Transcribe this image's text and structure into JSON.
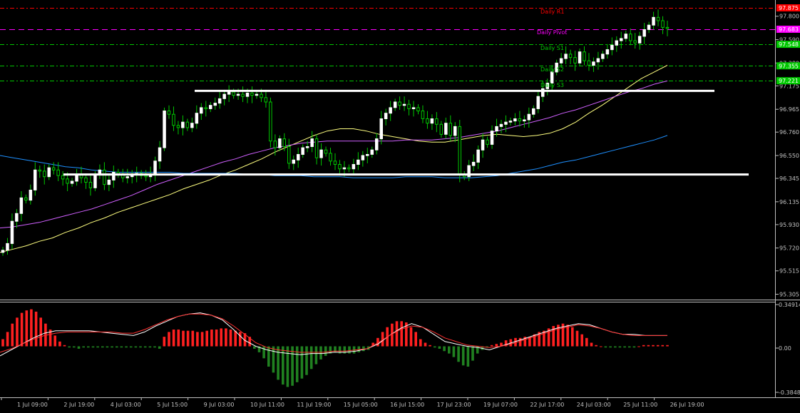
{
  "colors": {
    "background": "#000000",
    "axis": "#c0c0c0",
    "bull_candle": "#ffffff",
    "candle_wick": "#00c800",
    "r1_line": "#ff0000",
    "pivot_line": "#ff00ff",
    "support_line": "#00c800",
    "level_line": "#ffffff",
    "ma_fast": "#ffff80",
    "ma_mid": "#d060ff",
    "ma_slow": "#1e90ff",
    "hist_up": "#ff2020",
    "hist_down": "#208020",
    "signal_white": "#ffffff",
    "signal_red": "#ff3030"
  },
  "main": {
    "pivot_labels": [
      "Daily R1",
      "Daily Pivot",
      "Daily S1",
      "Daily S2",
      "Daily S3"
    ],
    "price_ticks": [
      "97.800",
      "97.590",
      "97.380",
      "97.175",
      "96.965",
      "96.760",
      "96.550",
      "96.345",
      "96.135",
      "95.930",
      "95.720",
      "95.515",
      "95.305"
    ],
    "price_tags": [
      {
        "text": "97.875",
        "value": 97.875,
        "color": "#ff0000",
        "kind": "r1"
      },
      {
        "text": "97.683",
        "value": 97.683,
        "color": "#ff00ff",
        "kind": "pivot"
      },
      {
        "text": "97.548",
        "value": 97.548,
        "color": "#00c800",
        "kind": "s1"
      },
      {
        "text": "97.355",
        "value": 97.355,
        "color": "#00c800",
        "kind": "s2"
      },
      {
        "text": "97.221",
        "value": 97.221,
        "color": "#00c800",
        "kind": "s3"
      }
    ]
  },
  "macd": {
    "ticks": [
      "0.34914",
      "0.00",
      "-0.38487"
    ]
  },
  "time_axis": {
    "labels": [
      "1 Jul 09:00",
      "2 Jul 19:00",
      "4 Jul 03:00",
      "5 Jul 15:00",
      "9 Jul 03:00",
      "10 Jul 11:00",
      "11 Jul 19:00",
      "15 Jul 05:00",
      "16 Jul 15:00",
      "17 Jul 23:00",
      "19 Jul 07:00",
      "22 Jul 17:00",
      "24 Jul 03:00",
      "25 Jul 11:00",
      "26 Jul 19:00"
    ]
  },
  "chart_data": [
    {
      "type": "candlestick",
      "y_axis": {
        "min": 95.27,
        "max": 97.92
      },
      "horizontal_levels": [
        {
          "name": "Daily R1",
          "value": 97.875
        },
        {
          "name": "Daily Pivot",
          "value": 97.683
        },
        {
          "name": "Daily S1",
          "value": 97.548
        },
        {
          "name": "Daily S2",
          "value": 97.355
        },
        {
          "name": "Daily S3",
          "value": 97.221
        },
        {
          "name": "resistance",
          "value": 97.13
        },
        {
          "name": "support",
          "value": 96.38
        }
      ],
      "closes": [
        95.7,
        95.76,
        95.96,
        96.03,
        96.17,
        96.15,
        96.24,
        96.42,
        96.41,
        96.36,
        96.44,
        96.42,
        96.37,
        96.34,
        96.3,
        96.32,
        96.38,
        96.35,
        96.31,
        96.26,
        96.38,
        96.42,
        96.29,
        96.33,
        96.4,
        96.38,
        96.35,
        96.36,
        96.38,
        96.39,
        96.37,
        96.36,
        96.38,
        96.5,
        96.62,
        96.95,
        96.92,
        96.82,
        96.8,
        96.85,
        96.8,
        96.84,
        96.93,
        96.98,
        96.97,
        97.0,
        97.02,
        97.06,
        97.1,
        97.12,
        97.09,
        97.1,
        97.08,
        97.11,
        97.09,
        97.1,
        97.07,
        97.03,
        96.68,
        96.62,
        96.7,
        96.63,
        96.48,
        96.51,
        96.56,
        96.62,
        96.63,
        96.7,
        96.53,
        96.6,
        96.57,
        96.5,
        96.47,
        96.43,
        96.44,
        96.43,
        96.47,
        96.51,
        96.55,
        96.56,
        96.6,
        96.7,
        96.88,
        96.93,
        96.98,
        97.03,
        97.0,
        97.01,
        96.97,
        96.98,
        96.95,
        96.88,
        96.84,
        96.88,
        96.83,
        96.74,
        96.84,
        96.73,
        96.81,
        96.38,
        96.36,
        96.46,
        96.49,
        96.6,
        96.69,
        96.65,
        96.77,
        96.81,
        96.83,
        96.85,
        96.86,
        96.88,
        96.86,
        96.87,
        96.92,
        96.97,
        97.08,
        97.15,
        97.2,
        97.3,
        97.38,
        97.42,
        97.46,
        97.43,
        97.38,
        97.48,
        97.4,
        97.36,
        97.39,
        97.42,
        97.46,
        97.5,
        97.54,
        97.58,
        97.6,
        97.64,
        97.58,
        97.56,
        97.62,
        97.68,
        97.72,
        97.79,
        97.76,
        97.7,
        97.69
      ],
      "moving_averages": [
        {
          "values": [
            95.68,
            95.71,
            95.74,
            95.78,
            95.81,
            95.86,
            95.9,
            95.95,
            95.99,
            96.04,
            96.08,
            96.12,
            96.16,
            96.2,
            96.25,
            96.29,
            96.33,
            96.38,
            96.42,
            96.47,
            96.52,
            96.58,
            96.63,
            96.68,
            96.73,
            96.77,
            96.79,
            96.79,
            96.77,
            96.74,
            96.72,
            96.7,
            96.68,
            96.67,
            96.67,
            96.69,
            96.71,
            96.73,
            96.74,
            96.73,
            96.72,
            96.73,
            96.75,
            96.79,
            96.85,
            96.93,
            97.0,
            97.08,
            97.16,
            97.24,
            97.3,
            97.36
          ]
        },
        {
          "values": [
            95.9,
            95.91,
            95.93,
            95.95,
            95.98,
            96.01,
            96.04,
            96.07,
            96.11,
            96.15,
            96.19,
            96.24,
            96.29,
            96.33,
            96.37,
            96.41,
            96.45,
            96.49,
            96.52,
            96.56,
            96.59,
            96.62,
            96.64,
            96.66,
            96.67,
            96.68,
            96.68,
            96.68,
            96.68,
            96.68,
            96.68,
            96.69,
            96.69,
            96.69,
            96.7,
            96.71,
            96.73,
            96.75,
            96.77,
            96.8,
            96.83,
            96.86,
            96.89,
            96.93,
            96.96,
            97.0,
            97.04,
            97.08,
            97.12,
            97.15,
            97.19,
            97.22
          ]
        },
        {
          "values": [
            96.55,
            96.53,
            96.51,
            96.49,
            96.47,
            96.45,
            96.44,
            96.42,
            96.41,
            96.4,
            96.4,
            96.4,
            96.4,
            96.4,
            96.39,
            96.39,
            96.39,
            96.39,
            96.39,
            96.38,
            96.38,
            96.37,
            96.37,
            96.37,
            96.36,
            96.36,
            96.36,
            96.35,
            96.35,
            96.35,
            96.35,
            96.36,
            96.36,
            96.36,
            96.35,
            96.35,
            96.35,
            96.36,
            96.37,
            96.39,
            96.41,
            96.43,
            96.46,
            96.49,
            96.51,
            96.54,
            96.57,
            96.6,
            96.63,
            96.66,
            96.69,
            96.73
          ]
        }
      ]
    },
    {
      "type": "bar",
      "name": "MACD",
      "y_axis": {
        "min": -0.38487,
        "max": 0.34914
      },
      "histogram": [
        0.06,
        0.12,
        0.19,
        0.24,
        0.28,
        0.3,
        0.31,
        0.29,
        0.24,
        0.19,
        0.14,
        0.09,
        0.04,
        0.01,
        -0.01,
        -0.01,
        -0.02,
        -0.01,
        -0.01,
        -0.01,
        -0.01,
        -0.01,
        -0.01,
        -0.01,
        -0.01,
        -0.01,
        -0.01,
        -0.01,
        -0.01,
        -0.01,
        -0.01,
        -0.01,
        -0.01,
        -0.02,
        0.08,
        0.12,
        0.14,
        0.14,
        0.13,
        0.13,
        0.13,
        0.12,
        0.12,
        0.13,
        0.14,
        0.14,
        0.15,
        0.15,
        0.14,
        0.13,
        0.12,
        0.11,
        0.08,
        -0.02,
        -0.05,
        -0.1,
        -0.17,
        -0.22,
        -0.28,
        -0.32,
        -0.34,
        -0.33,
        -0.3,
        -0.27,
        -0.24,
        -0.19,
        -0.15,
        -0.11,
        -0.08,
        -0.06,
        -0.05,
        -0.06,
        -0.06,
        -0.06,
        -0.06,
        -0.05,
        -0.04,
        -0.03,
        0.03,
        0.07,
        0.12,
        0.16,
        0.19,
        0.21,
        0.21,
        0.2,
        0.16,
        0.12,
        0.06,
        0.03,
        0.01,
        -0.01,
        -0.02,
        -0.04,
        -0.06,
        -0.09,
        -0.13,
        -0.16,
        -0.17,
        -0.12,
        -0.06,
        -0.03,
        -0.01,
        0.01,
        0.02,
        0.03,
        0.05,
        0.06,
        0.07,
        0.07,
        0.08,
        0.08,
        0.1,
        0.12,
        0.13,
        0.15,
        0.17,
        0.18,
        0.19,
        0.18,
        0.16,
        0.13,
        0.1,
        0.07,
        0.03,
        0.01,
        0.0,
        -0.01,
        -0.01,
        -0.01,
        -0.01,
        -0.01,
        -0.01,
        -0.01,
        0.0,
        0.01,
        0.01,
        0.01,
        0.01,
        0.01,
        0.01
      ],
      "signal_lines": [
        {
          "values": [
            -0.08,
            -0.03,
            0.02,
            0.07,
            0.11,
            0.13,
            0.13,
            0.13,
            0.13,
            0.12,
            0.11,
            0.1,
            0.09,
            0.12,
            0.17,
            0.21,
            0.25,
            0.27,
            0.28,
            0.26,
            0.22,
            0.14,
            0.05,
            0.0,
            -0.03,
            -0.05,
            -0.06,
            -0.07,
            -0.06,
            -0.06,
            -0.05,
            -0.05,
            -0.04,
            -0.02,
            0.02,
            0.09,
            0.15,
            0.19,
            0.16,
            0.1,
            0.04,
            0.02,
            0.0,
            -0.01,
            -0.03,
            0.0,
            0.03,
            0.06,
            0.09,
            0.12,
            0.15,
            0.17,
            0.19,
            0.18,
            0.15,
            0.12,
            0.1,
            0.1,
            0.09,
            0.09,
            0.09
          ]
        },
        {
          "values": [
            -0.05,
            -0.02,
            0.02,
            0.06,
            0.09,
            0.11,
            0.12,
            0.12,
            0.12,
            0.12,
            0.12,
            0.11,
            0.11,
            0.14,
            0.18,
            0.22,
            0.25,
            0.27,
            0.27,
            0.26,
            0.23,
            0.17,
            0.1,
            0.03,
            -0.01,
            -0.03,
            -0.04,
            -0.05,
            -0.05,
            -0.05,
            -0.04,
            -0.04,
            -0.03,
            -0.02,
            0.03,
            0.09,
            0.14,
            0.17,
            0.16,
            0.12,
            0.07,
            0.04,
            0.01,
            0.0,
            -0.01,
            0.0,
            0.02,
            0.05,
            0.08,
            0.11,
            0.14,
            0.16,
            0.18,
            0.17,
            0.15,
            0.12,
            0.1,
            0.09,
            0.09,
            0.09,
            0.09
          ]
        }
      ]
    }
  ]
}
